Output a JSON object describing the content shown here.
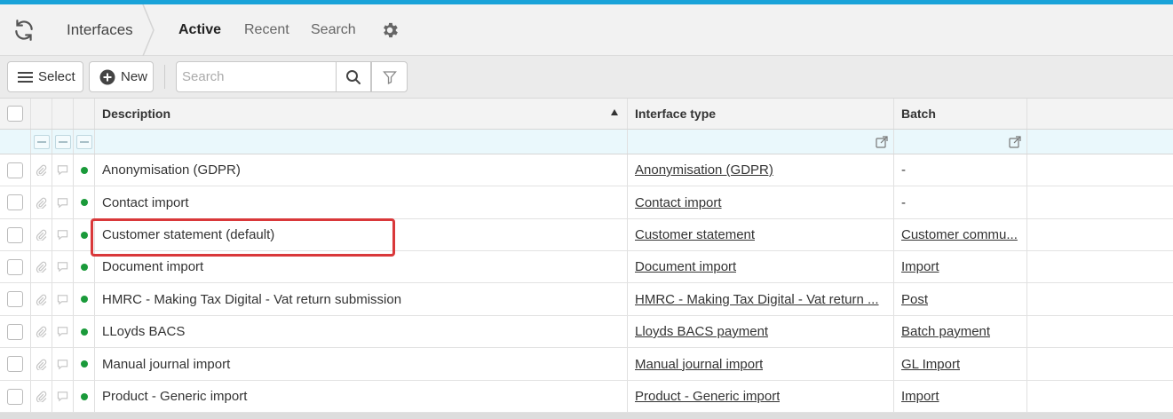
{
  "header": {
    "title": "Interfaces",
    "tabs": [
      {
        "label": "Active",
        "active": true
      },
      {
        "label": "Recent",
        "active": false
      },
      {
        "label": "Search",
        "active": false
      }
    ]
  },
  "toolbar": {
    "select_label": "Select",
    "new_label": "New",
    "search_placeholder": "Search"
  },
  "table": {
    "columns": {
      "description": "Description",
      "interface_type": "Interface type",
      "batch": "Batch"
    },
    "sort": {
      "column": "Description",
      "direction": "ascending"
    },
    "rows": [
      {
        "description": "Anonymisation (GDPR)",
        "interface_type": "Anonymisation (GDPR)",
        "batch": "-",
        "status": "active"
      },
      {
        "description": "Contact import",
        "interface_type": "Contact import",
        "batch": "-",
        "status": "active"
      },
      {
        "description": "Customer statement (default)",
        "interface_type": "Customer statement",
        "batch": "Customer commu...",
        "status": "active"
      },
      {
        "description": "Document import",
        "interface_type": "Document import",
        "batch": "Import",
        "status": "active"
      },
      {
        "description": "HMRC - Making Tax Digital - Vat return submission",
        "interface_type": "HMRC - Making Tax Digital - Vat return ...",
        "batch": "Post",
        "status": "active"
      },
      {
        "description": "LLoyds BACS",
        "interface_type": "Lloyds BACS payment",
        "batch": "Batch payment",
        "status": "active"
      },
      {
        "description": "Manual journal import",
        "interface_type": "Manual journal import",
        "batch": "GL Import",
        "status": "active"
      },
      {
        "description": "Product - Generic import",
        "interface_type": "Product - Generic import",
        "batch": "Import",
        "status": "active"
      }
    ]
  },
  "colors": {
    "accent": "#1aa3d9",
    "status_active": "#1a9a3a",
    "highlight": "#d9383a",
    "filter_row_bg": "#eaf8fc"
  },
  "icons": [
    "refresh-icon",
    "gear-icon",
    "menu-icon",
    "plus-circle-icon",
    "search-icon",
    "filter-icon",
    "paperclip-icon",
    "comment-icon",
    "external-link-icon"
  ]
}
